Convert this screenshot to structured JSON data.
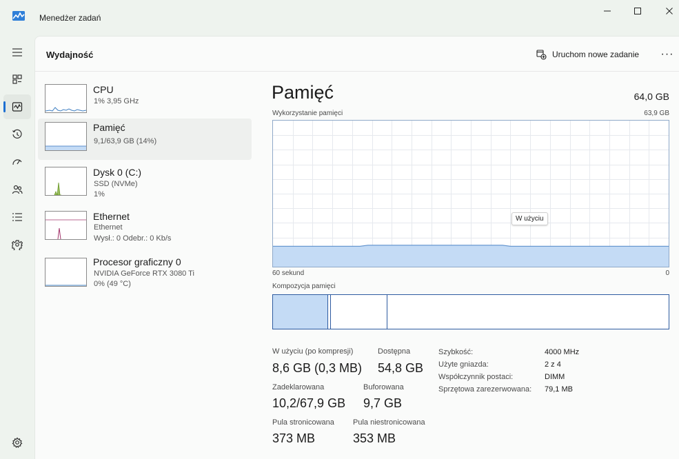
{
  "window": {
    "title": "Menedżer zadań",
    "controls": [
      "minimize-icon",
      "maximize-icon",
      "close-icon"
    ]
  },
  "nav": {
    "items": [
      {
        "icon": "hamburger-menu-icon"
      },
      {
        "icon": "processes-icon"
      },
      {
        "icon": "performance-icon",
        "active": true
      },
      {
        "icon": "app-history-icon"
      },
      {
        "icon": "startup-apps-icon"
      },
      {
        "icon": "users-icon"
      },
      {
        "icon": "details-icon"
      },
      {
        "icon": "services-icon"
      },
      {
        "icon": "settings-icon"
      }
    ]
  },
  "header": {
    "title": "Wydajność",
    "run_task_label": "Uruchom nowe zadanie",
    "more_label": "···"
  },
  "devices": [
    {
      "name": "CPU",
      "sub1": "1% 3,95 GHz",
      "sub2": "",
      "sub3": ""
    },
    {
      "name": "Pamięć",
      "sub1": "9,1/63,9 GB (14%)",
      "sub2": "",
      "sub3": "",
      "selected": true
    },
    {
      "name": "Dysk 0 (C:)",
      "sub1": "SSD (NVMe)",
      "sub2": "1%",
      "sub3": ""
    },
    {
      "name": "Ethernet",
      "sub1": "Ethernet",
      "sub2": "Wysł.: 0 Odebr.: 0 Kb/s",
      "sub3": ""
    },
    {
      "name": "Procesor graficzny 0",
      "sub1": "NVIDIA GeForce RTX 3080 Ti",
      "sub2": "0% (49 °C)",
      "sub3": ""
    }
  ],
  "memory": {
    "title": "Pamięć",
    "total": "64,0 GB",
    "usage_label": "Wykorzystanie pamięci",
    "usage_max": "63,9 GB",
    "time_left": "60 sekund",
    "time_right": "0",
    "tooltip": "W użyciu",
    "composition_label": "Kompozycja pamięci",
    "usage_fraction": 0.14
  },
  "stats": {
    "in_use_label": "W użyciu (po kompresji)",
    "in_use_value": "8,6 GB (0,3 MB)",
    "available_label": "Dostępna",
    "available_value": "54,8 GB",
    "committed_label": "Zadeklarowana",
    "committed_value": "10,2/67,9 GB",
    "cached_label": "Buforowana",
    "cached_value": "9,7 GB",
    "paged_label": "Pula stronicowana",
    "paged_value": "373 MB",
    "nonpaged_label": "Pula niestronicowana",
    "nonpaged_value": "353 MB"
  },
  "specs": {
    "speed_label": "Szybkość:",
    "speed_value": "4000 MHz",
    "slots_label": "Użyte gniazda:",
    "slots_value": "2 z 4",
    "form_label": "Współczynnik postaci:",
    "form_value": "DIMM",
    "reserved_label": "Sprzętowa zarezerwowana:",
    "reserved_value": "79,1 MB"
  },
  "colors": {
    "memory_line": "#5b8fcc",
    "memory_fill": "#c4dbf5",
    "cpu_line": "#3f7fc2",
    "disk_line": "#6b9a2a",
    "ethernet_line": "#a3346b",
    "accent": "#1d6fd1"
  }
}
